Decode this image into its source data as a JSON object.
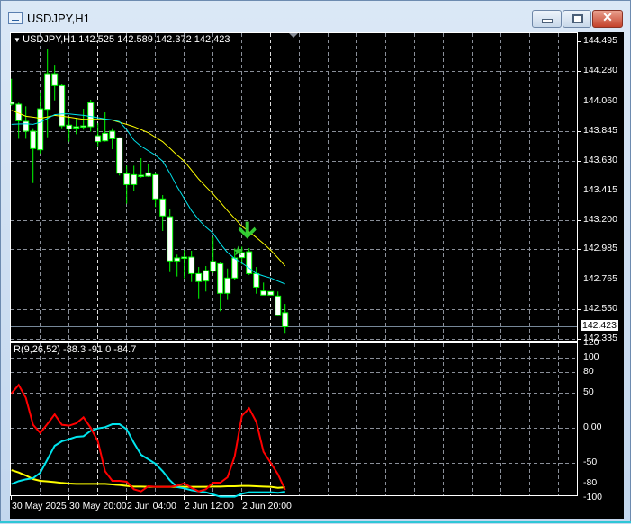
{
  "window": {
    "title": "USDJPY,H1",
    "icon": "chart-window-icon",
    "buttons": {
      "minimize": "minimize-icon",
      "maximize": "maximize-icon",
      "close": "close-icon"
    }
  },
  "chart": {
    "header": "USDJPY,H1  142.525 142.589 142.372 142.423",
    "symbol": "USDJPY",
    "timeframe": "H1",
    "colors": {
      "background": "#000000",
      "candle_outline": "#00ff00",
      "candle_body": "#ffffff",
      "ma_fast": "#00e5ee",
      "ma_slow": "#ffff00",
      "signal": "#33cc33",
      "grid": "#8a8f99"
    },
    "price_labels": [
      "144.495",
      "144.280",
      "144.060",
      "143.845",
      "143.630",
      "143.415",
      "143.200",
      "142.985",
      "142.765",
      "142.550",
      "142.335"
    ],
    "current_price": "142.423",
    "time_labels": [
      "30 May 2025",
      "30 May 20:00",
      "2 Jun 04:00",
      "2 Jun 12:00",
      "2 Jun 20:00"
    ],
    "signals": [
      {
        "type": "sell-arrow",
        "candle": 33
      },
      {
        "type": "star",
        "candle": 32
      }
    ]
  },
  "indicator": {
    "header": "R(9,26,52) -88.3 -91.0 -84.7",
    "levels": [
      "120",
      "100",
      "80",
      "50",
      "0.00",
      "-50",
      "-80",
      "-100"
    ],
    "colors": {
      "fast": "#ff0000",
      "medium": "#00e5ee",
      "slow": "#ffff00"
    }
  },
  "chart_data": {
    "type": "candlestick",
    "ylim": [
      142.335,
      144.495
    ],
    "ohlc": [
      [
        144.04,
        144.225,
        144.029,
        144.055
      ],
      [
        144.04,
        144.051,
        143.789,
        143.92
      ],
      [
        143.916,
        144.025,
        143.789,
        143.844
      ],
      [
        143.844,
        143.866,
        143.467,
        143.718
      ],
      [
        143.709,
        144.127,
        143.681,
        144.007
      ],
      [
        144.003,
        144.443,
        143.8,
        144.262
      ],
      [
        144.262,
        144.327,
        144.068,
        144.175
      ],
      [
        144.175,
        144.186,
        143.866,
        143.883
      ],
      [
        143.888,
        143.942,
        143.768,
        143.861
      ],
      [
        143.87,
        143.942,
        143.822,
        143.877
      ],
      [
        143.874,
        144.007,
        143.855,
        143.883
      ],
      [
        143.877,
        144.073,
        143.84,
        144.051
      ],
      [
        143.811,
        143.903,
        143.735,
        143.768
      ],
      [
        143.774,
        143.981,
        143.768,
        143.829
      ],
      [
        143.844,
        143.866,
        143.713,
        143.789
      ],
      [
        143.796,
        143.8,
        143.522,
        143.539
      ],
      [
        143.535,
        143.593,
        143.317,
        143.456
      ],
      [
        143.456,
        143.593,
        143.408,
        143.528
      ],
      [
        143.524,
        143.648,
        143.506,
        143.517
      ],
      [
        143.517,
        143.609,
        143.511,
        143.541
      ],
      [
        143.528,
        143.539,
        143.293,
        143.352
      ],
      [
        143.352,
        143.38,
        143.119,
        143.228
      ],
      [
        143.223,
        143.282,
        142.82,
        142.901
      ],
      [
        142.901,
        142.947,
        142.788,
        142.923
      ],
      [
        142.92,
        142.979,
        142.775,
        142.929
      ],
      [
        142.929,
        142.975,
        142.748,
        142.809
      ],
      [
        142.809,
        142.857,
        142.624,
        142.751
      ],
      [
        142.755,
        142.864,
        142.679,
        142.831
      ],
      [
        142.827,
        143.075,
        142.814,
        142.897
      ],
      [
        142.881,
        142.892,
        142.535,
        142.666
      ],
      [
        142.666,
        142.846,
        142.618,
        142.777
      ],
      [
        142.777,
        142.992,
        142.766,
        142.923
      ],
      [
        142.925,
        143.005,
        142.875,
        142.962
      ],
      [
        142.968,
        142.994,
        142.798,
        142.809
      ],
      [
        142.809,
        142.857,
        142.663,
        142.711
      ],
      [
        142.683,
        142.744,
        142.653,
        142.653
      ],
      [
        142.679,
        142.679,
        142.653,
        142.653
      ],
      [
        142.646,
        142.679,
        142.5,
        142.504
      ],
      [
        142.525,
        142.589,
        142.372,
        142.423
      ]
    ],
    "ma_fast": [
      143.894,
      143.896,
      143.898,
      143.894,
      143.909,
      143.938,
      143.964,
      143.97,
      143.97,
      143.964,
      143.959,
      143.951,
      143.942,
      143.933,
      143.927,
      143.914,
      143.855,
      143.779,
      143.735,
      143.702,
      143.67,
      143.626,
      143.539,
      143.441,
      143.354,
      143.267,
      143.201,
      143.147,
      143.103,
      143.027,
      142.962,
      142.918,
      142.886,
      142.849,
      142.809,
      142.792,
      142.777,
      142.755,
      142.734
    ],
    "ma_slow": [
      143.996,
      143.975,
      143.953,
      143.946,
      143.938,
      143.948,
      143.959,
      143.953,
      143.946,
      143.938,
      143.931,
      143.931,
      143.931,
      143.929,
      143.925,
      143.909,
      143.894,
      143.877,
      143.855,
      143.833,
      143.8,
      143.768,
      143.72,
      143.67,
      143.626,
      143.561,
      143.496,
      143.441,
      143.387,
      143.328,
      143.267,
      143.21,
      143.154,
      143.112,
      143.071,
      143.027,
      142.979,
      142.923,
      142.864
    ],
    "indicator_ylim": [
      -100,
      120
    ],
    "indicator_fast": [
      49.1,
      61.1,
      42.7,
      4.3,
      -7.3,
      5.6,
      19.2,
      4.3,
      3.0,
      6.4,
      14.9,
      0,
      -19.2,
      -62,
      -75.6,
      -75.6,
      -76.9,
      -87.6,
      -90.6,
      -83.3,
      -84.2,
      -84.2,
      -84.2,
      -82.5,
      -79.1,
      -85.5,
      -90.6,
      -87.6,
      -78.2,
      -78.2,
      -70.5,
      -40.6,
      17.1,
      27.8,
      8.5,
      -34.2,
      -50,
      -66.2,
      -88.3
    ],
    "indicator_medium": [
      -80.3,
      -76.1,
      -73.5,
      -71.8,
      -64.1,
      -44.9,
      -25.6,
      -19.2,
      -16.2,
      -12.8,
      -12,
      -4.3,
      -0.9,
      0.9,
      5.1,
      5.1,
      -2.1,
      -21.4,
      -38.5,
      -44.9,
      -51.3,
      -61.9,
      -74.8,
      -84.6,
      -86.3,
      -88.9,
      -90.6,
      -91.9,
      -94.9,
      -98.3,
      -98.3,
      -98.3,
      -94,
      -91.9,
      -91.9,
      -91.9,
      -91.9,
      -92.7,
      -91.0
    ],
    "indicator_slow": [
      -60.3,
      -63.7,
      -68,
      -73.1,
      -75.6,
      -76.5,
      -77.4,
      -78.6,
      -79.5,
      -79.9,
      -79.9,
      -79.9,
      -79.9,
      -79.9,
      -80.8,
      -81.6,
      -82.9,
      -83.8,
      -83.8,
      -84.2,
      -84.2,
      -84.2,
      -84.2,
      -84.2,
      -84.2,
      -84.2,
      -84.2,
      -84.2,
      -83.8,
      -83.8,
      -83.3,
      -83.3,
      -82.9,
      -82.9,
      -83.3,
      -83.8,
      -84.2,
      -85.5,
      -84.7
    ]
  }
}
